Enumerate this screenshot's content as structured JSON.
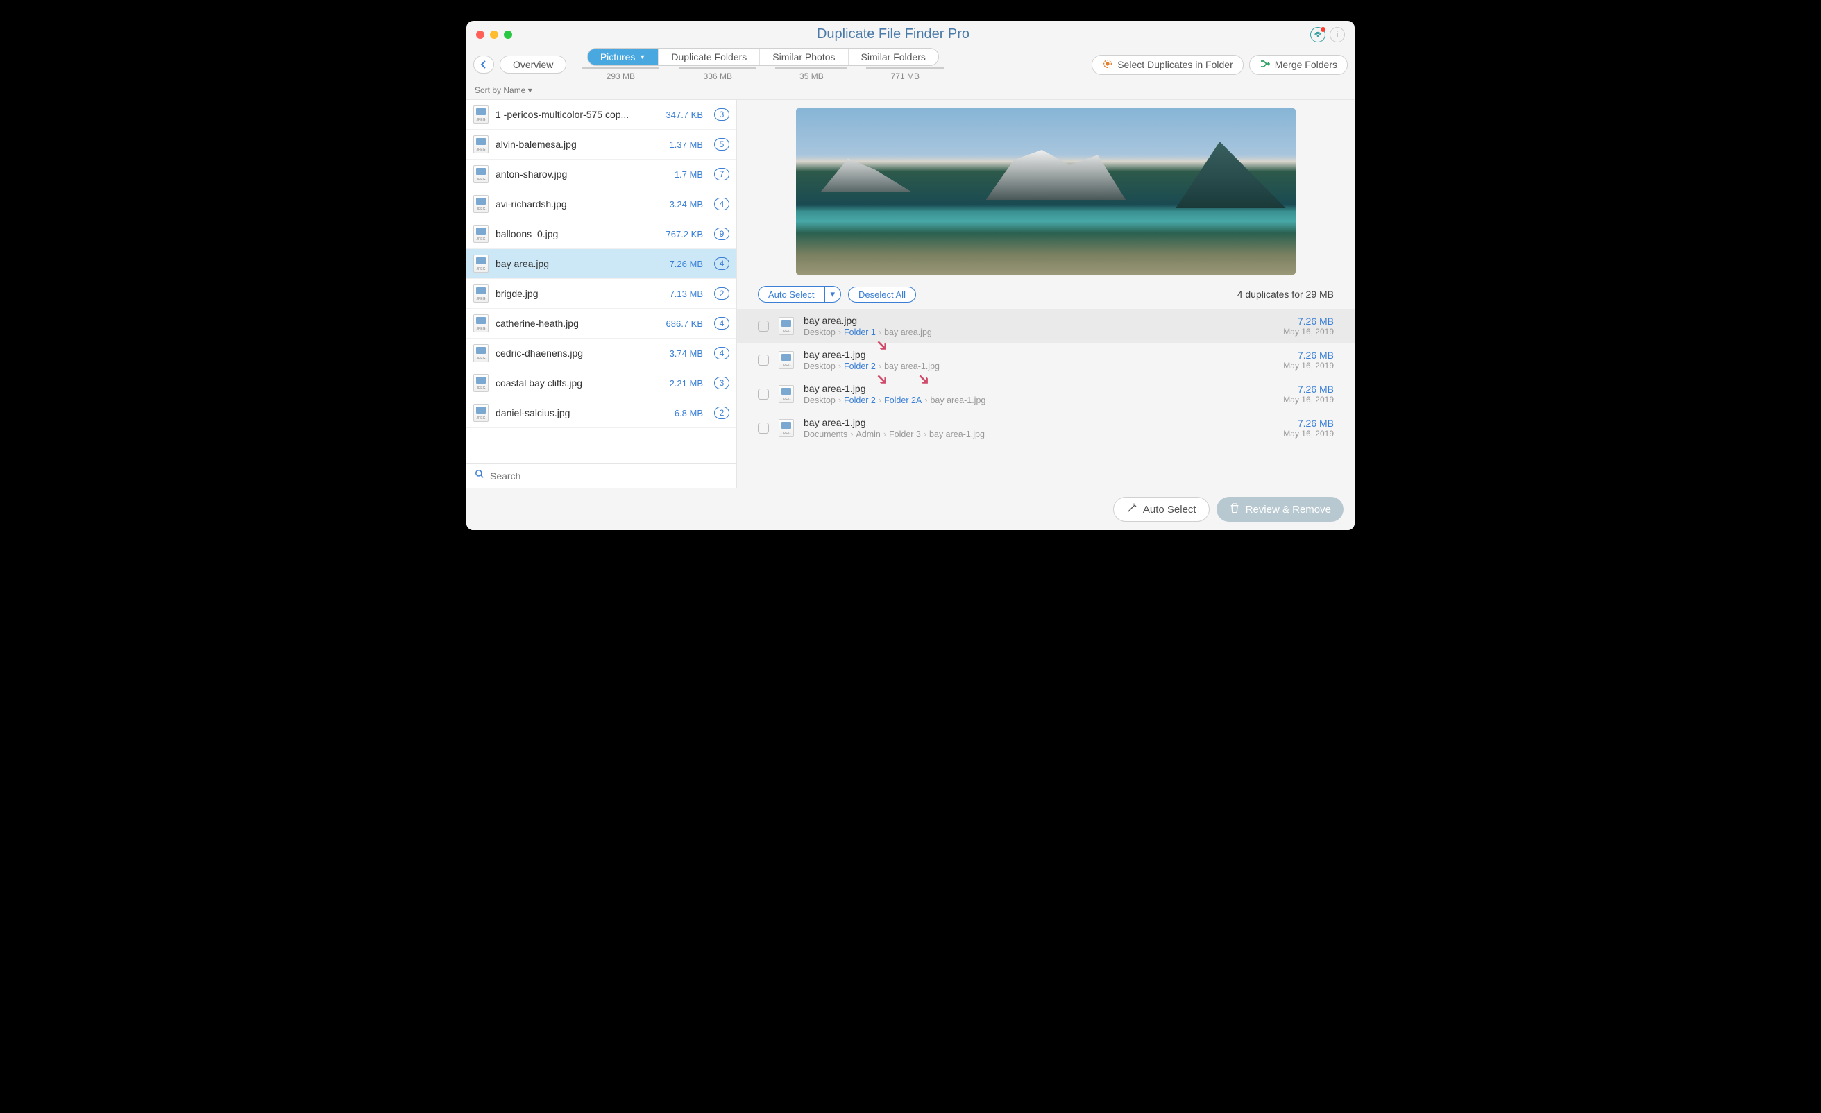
{
  "window": {
    "title": "Duplicate File Finder Pro"
  },
  "toolbar": {
    "overview": "Overview",
    "back": "‹",
    "select_duplicates": "Select Duplicates in Folder",
    "merge_folders": "Merge Folders"
  },
  "tabs": [
    {
      "label": "Pictures",
      "size": "293 MB",
      "active": true,
      "w": 140
    },
    {
      "label": "Duplicate Folders",
      "size": "336 MB",
      "active": false,
      "w": 140
    },
    {
      "label": "Similar Photos",
      "size": "35 MB",
      "active": false,
      "w": 130
    },
    {
      "label": "Similar Folders",
      "size": "771 MB",
      "active": false,
      "w": 140
    }
  ],
  "sort": {
    "label": "Sort by Name ▾"
  },
  "files": [
    {
      "name": "1 -pericos-multicolor-575 cop...",
      "size": "347.7 KB",
      "count": "3"
    },
    {
      "name": "alvin-balemesa.jpg",
      "size": "1.37 MB",
      "count": "5"
    },
    {
      "name": "anton-sharov.jpg",
      "size": "1.7 MB",
      "count": "7"
    },
    {
      "name": "avi-richardsh.jpg",
      "size": "3.24 MB",
      "count": "4"
    },
    {
      "name": "balloons_0.jpg",
      "size": "767.2 KB",
      "count": "9"
    },
    {
      "name": "bay area.jpg",
      "size": "7.26 MB",
      "count": "4",
      "selected": true
    },
    {
      "name": "brigde.jpg",
      "size": "7.13 MB",
      "count": "2"
    },
    {
      "name": "catherine-heath.jpg",
      "size": "686.7 KB",
      "count": "4"
    },
    {
      "name": "cedric-dhaenens.jpg",
      "size": "3.74 MB",
      "count": "4"
    },
    {
      "name": "coastal bay cliffs.jpg",
      "size": "2.21 MB",
      "count": "3"
    },
    {
      "name": "daniel-salcius.jpg",
      "size": "6.8 MB",
      "count": "2"
    }
  ],
  "search": {
    "placeholder": "Search"
  },
  "selection_bar": {
    "auto_select": "Auto Select",
    "deselect_all": "Deselect All",
    "summary": "4 duplicates for 29 MB"
  },
  "duplicates": [
    {
      "name": "bay area.jpg",
      "path": [
        "Desktop",
        "Folder 1",
        "bay area.jpg"
      ],
      "hl": [
        1
      ],
      "size": "7.26 MB",
      "date": "May 16, 2019",
      "sel": true
    },
    {
      "name": "bay area-1.jpg",
      "path": [
        "Desktop",
        "Folder 2",
        "bay area-1.jpg"
      ],
      "hl": [
        1
      ],
      "size": "7.26 MB",
      "date": "May 16, 2019",
      "arrow": [
        140
      ]
    },
    {
      "name": "bay area-1.jpg",
      "path": [
        "Desktop",
        "Folder 2",
        "Folder 2A",
        "bay area-1.jpg"
      ],
      "hl": [
        1,
        2
      ],
      "size": "7.26 MB",
      "date": "May 16, 2019",
      "arrow": [
        140,
        200
      ]
    },
    {
      "name": "bay area-1.jpg",
      "path": [
        "Documents",
        "Admin",
        "Folder 3",
        "bay area-1.jpg"
      ],
      "hl": [],
      "size": "7.26 MB",
      "date": "May 16, 2019"
    }
  ],
  "footer": {
    "auto_select": "Auto Select",
    "review": "Review & Remove"
  }
}
